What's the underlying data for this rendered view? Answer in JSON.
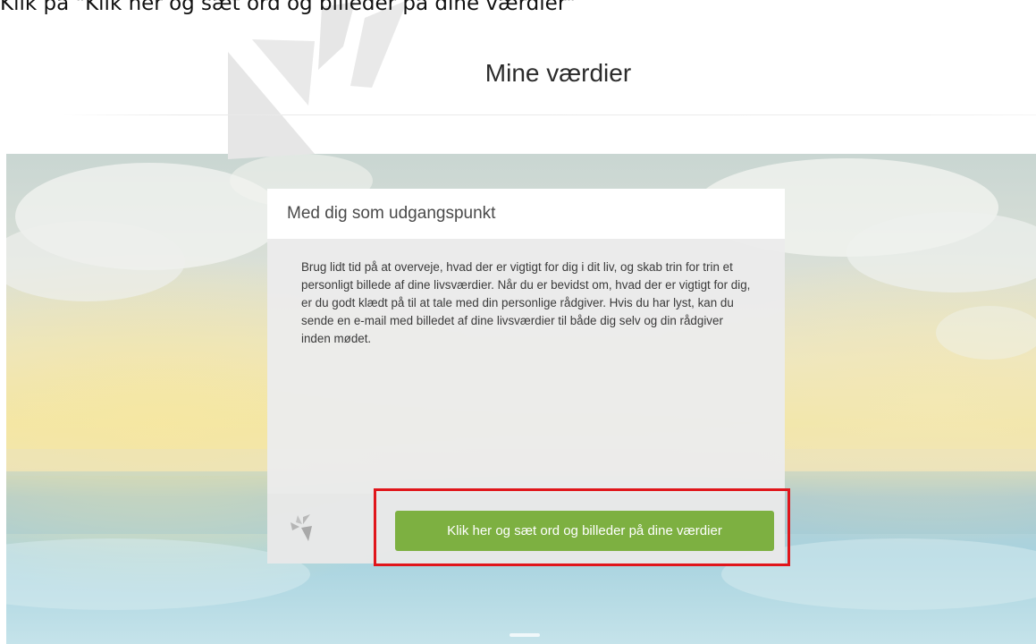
{
  "instruction": {
    "text": "Klik på \"Klik her og sæt ord og billeder på dine værdier\""
  },
  "header": {
    "title": "Mine værdier",
    "logo_color": "#e7e7e7"
  },
  "card": {
    "title": "Med dig som udgangspunkt",
    "body": "Brug lidt tid på at overveje, hvad der er vigtigt for dig i dit liv, og skab trin for trin et personligt billede af dine livsværdier. Når du er bevidst om, hvad der er vigtigt for dig, er du godt klædt på til at tale med din personlige rådgiver. Hvis du har lyst, kan du sende en e-mail med billedet af dine livsværdier til både dig selv og din rådgiver inden mødet.",
    "cta_label": "Klik her og sæt ord og billeder på dine værdier",
    "cta_color": "#7db041",
    "footer_icon": "bird-logo-icon"
  },
  "highlight": {
    "color": "#e0161b"
  }
}
